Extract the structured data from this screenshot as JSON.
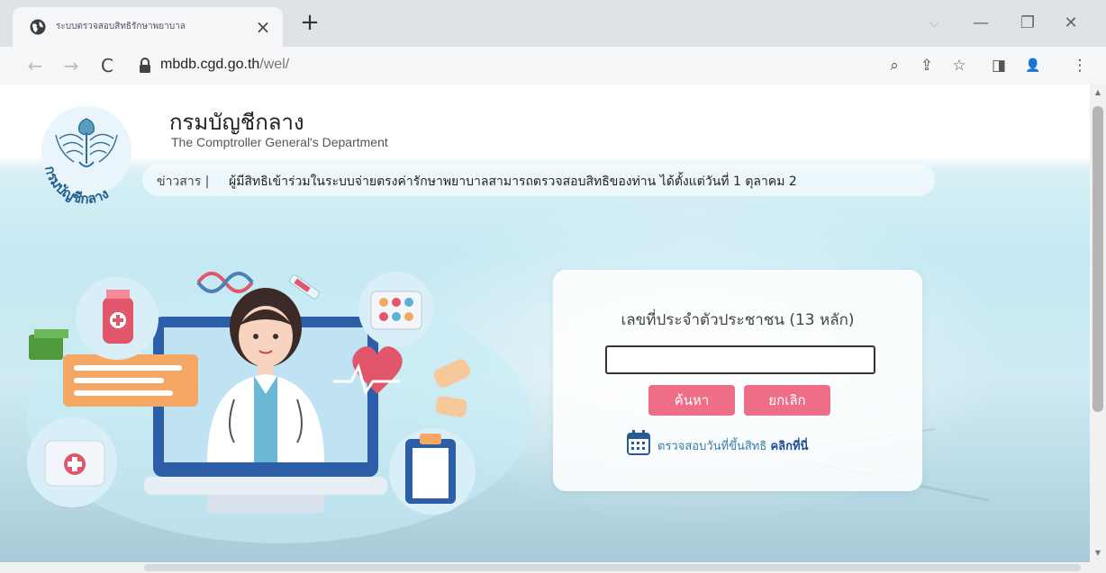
{
  "browser": {
    "tab_title": "ระบบตรวจสอบสิทธิรักษาพยาบาล",
    "tab_close": "×",
    "new_tab": "+",
    "window_controls": {
      "chevron": "⌵",
      "minimize": "—",
      "restore": "❐",
      "close": "✕"
    },
    "nav": {
      "back": "←",
      "forward": "→",
      "reload": "C"
    },
    "url_domain": "mbdb.cgd.go.th",
    "url_path": "/wel/",
    "toolbar_icons": [
      "zoom-icon",
      "share-icon",
      "bookmark-star-icon",
      "side-panel-icon",
      "profile-icon",
      "menu-icon"
    ],
    "toolbar_glyphs": {
      "zoom": "⌕",
      "share": "⇪",
      "star": "☆",
      "panel": "◨",
      "profile": "👤",
      "menu": "⋮"
    }
  },
  "header": {
    "title": "กรมบัญชีกลาง",
    "subtitle": "The Comptroller General's Department",
    "logo_text": "กรมบัญชีกลาง"
  },
  "news": {
    "label": "ข่าวสาร |",
    "text": "ผู้มีสิทธิเข้าร่วมในระบบจ่ายตรงค่ารักษาพยาบาลสามารถตรวจสอบสิทธิของท่าน ได้ตั้งแต่วันที่ 1 ตุลาคม 2"
  },
  "login": {
    "label": "เลขที่ประจำตัวประชาชน (13 หลัก)",
    "input_value": "",
    "search_button": "ค้นหา",
    "cancel_button": "ยกเลิก",
    "check_text": "ตรวจสอบวันที่ขึ้นสิทธิ ",
    "check_link": "คลิกที่นี่"
  },
  "colors": {
    "button": "#ee6e88",
    "link": "#1d4f91",
    "background_top": "#d8f0f6"
  }
}
